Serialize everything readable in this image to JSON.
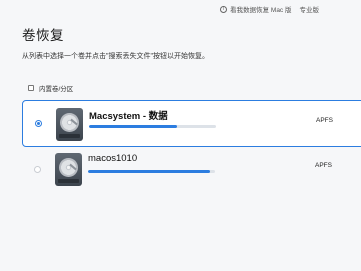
{
  "topbar": {
    "upgrade_label": "看我数据恢复 Mac 版",
    "pro_label": "专业版"
  },
  "page": {
    "title": "卷恢复",
    "subtitle": "从列表中选择一个卷并点击\"搜索丢失文件\"按钮以开始恢复。"
  },
  "section": {
    "header": "内置卷/分区"
  },
  "volumes": [
    {
      "name": "Macsystem - 数据",
      "filesystem": "APFS",
      "usage": 0.69,
      "selected": true
    },
    {
      "name": "macos1010",
      "filesystem": "APFS",
      "usage": 0.96,
      "selected": false
    }
  ],
  "colors": {
    "accent": "#2c7de0",
    "bar_track": "#dde2e8",
    "background": "#f6f7f9"
  }
}
